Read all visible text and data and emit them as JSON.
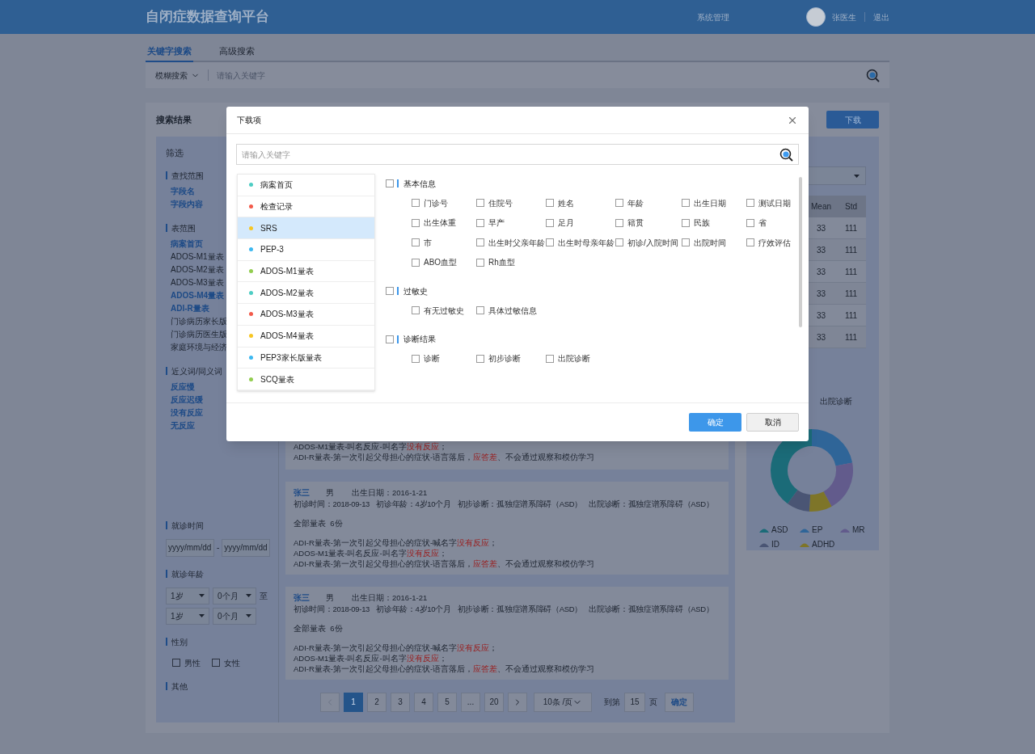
{
  "header": {
    "title": "自闭症数据查询平台",
    "nav": "系统管理",
    "user": "张医生",
    "logout": "退出"
  },
  "search_tabs": [
    {
      "label": "关键字搜索",
      "selected": true
    },
    {
      "label": "高级搜索",
      "selected": false
    }
  ],
  "search_bar": {
    "mode": "模糊搜索",
    "placeholder": "请输入关键字"
  },
  "results": {
    "title": "搜索结果",
    "download_button": "下载"
  },
  "filters": {
    "title": "筛选",
    "sections": [
      {
        "kind": "links",
        "title": "查找范围",
        "items": [
          {
            "label": "字段名",
            "selected": true
          },
          {
            "label": "字段内容",
            "selected": true
          }
        ]
      },
      {
        "kind": "links",
        "title": "表范围",
        "items": [
          {
            "label": "病案首页",
            "selected": true
          },
          {
            "label": "ADOS-M1量表",
            "selected": false
          },
          {
            "label": "ADOS-M2量表",
            "selected": false
          },
          {
            "label": "ADOS-M3量表",
            "selected": false
          },
          {
            "label": "ADOS-M4量表",
            "selected": true
          },
          {
            "label": "ADI-R量表",
            "selected": true
          },
          {
            "label": "门诊病历家长版",
            "selected": false
          },
          {
            "label": "门诊病历医生版",
            "selected": false
          },
          {
            "label": "家庭环境与经济",
            "selected": false
          }
        ]
      },
      {
        "kind": "links",
        "title": "近义词/同义词",
        "items": [
          {
            "label": "反应慢",
            "selected": true
          },
          {
            "label": "反应迟缓",
            "selected": true
          },
          {
            "label": "没有反应",
            "selected": true
          },
          {
            "label": "无反应",
            "selected": true
          }
        ]
      },
      {
        "kind": "dates",
        "title": "就诊时间",
        "separator": "-",
        "fields": [
          {
            "placeholder": "yyyy/mm/dd"
          },
          {
            "placeholder": "yyyy/mm/dd"
          }
        ]
      },
      {
        "kind": "ages",
        "title": "就诊年龄",
        "to": "至",
        "rows": [
          [
            "1岁",
            "0个月"
          ],
          [
            "1岁",
            "0个月"
          ]
        ]
      },
      {
        "kind": "checks",
        "title": "性别",
        "items": [
          {
            "label": "男性",
            "checked": false
          },
          {
            "label": "女性",
            "checked": false
          }
        ]
      },
      {
        "kind": "links",
        "title": "其他"
      }
    ]
  },
  "records": [
    {
      "lines": [
        [
          {
            "text": "ADOS-M1量表-叫名反应-叫名字",
            "highlight": false
          },
          {
            "text": "没有反应",
            "highlight": true
          },
          {
            "text": "；",
            "highlight": false
          }
        ],
        [
          {
            "text": "ADI-R量表-第一次引起父母担心的症状-语言落后，",
            "highlight": false
          },
          {
            "text": "应答差",
            "highlight": true
          },
          {
            "text": "、不会通过观察和模仿学习",
            "highlight": false
          }
        ]
      ]
    },
    {
      "name": "张三",
      "gender": "男",
      "birth": "出生日期：2016-1-21",
      "details": [
        "初诊时间：2018-09-13",
        "初诊年龄：4岁10个月",
        "初步诊断：孤独症谱系障碍（ASD）",
        "出院诊断：孤独症谱系障碍（ASD）"
      ],
      "scale_count": "全部量表  6份",
      "lines": [
        [
          {
            "text": "ADI-R量表-第一次引起父母担心的症状-喊名字",
            "highlight": false
          },
          {
            "text": "没有反应",
            "highlight": true
          },
          {
            "text": "；",
            "highlight": false
          }
        ],
        [
          {
            "text": "ADOS-M1量表-叫名反应-叫名字",
            "highlight": false
          },
          {
            "text": "没有反应",
            "highlight": true
          },
          {
            "text": "；",
            "highlight": false
          }
        ],
        [
          {
            "text": "ADI-R量表-第一次引起父母担心的症状-语言落后，",
            "highlight": false
          },
          {
            "text": "应答差",
            "highlight": true
          },
          {
            "text": "、不会通过观察和模仿学习",
            "highlight": false
          }
        ]
      ]
    },
    {
      "name": "张三",
      "gender": "男",
      "birth": "出生日期：2016-1-21",
      "details": [
        "初诊时间：2018-09-13",
        "初诊年龄：4岁10个月",
        "初步诊断：孤独症谱系障碍（ASD）",
        "出院诊断：孤独症谱系障碍（ASD）"
      ],
      "scale_count": "全部量表  6份",
      "lines": [
        [
          {
            "text": "ADI-R量表-第一次引起父母担心的症状-喊名字",
            "highlight": false
          },
          {
            "text": "没有反应",
            "highlight": true
          },
          {
            "text": "；",
            "highlight": false
          }
        ],
        [
          {
            "text": "ADOS-M1量表-叫名反应-叫名字",
            "highlight": false
          },
          {
            "text": "没有反应",
            "highlight": true
          },
          {
            "text": "；",
            "highlight": false
          }
        ],
        [
          {
            "text": "ADI-R量表-第一次引起父母担心的症状-语言落后，",
            "highlight": false
          },
          {
            "text": "应答差",
            "highlight": true
          },
          {
            "text": "、不会通过观察和模仿学习",
            "highlight": false
          }
        ]
      ]
    }
  ],
  "pagination": {
    "prev_disabled": true,
    "pages": [
      {
        "label": "1",
        "selected": true
      },
      {
        "label": "2",
        "selected": false
      },
      {
        "label": "3",
        "selected": false
      },
      {
        "label": "4",
        "selected": false
      },
      {
        "label": "5",
        "selected": false
      },
      {
        "label": "...",
        "selected": false
      },
      {
        "label": "20",
        "selected": false
      }
    ],
    "page_size": "10条 /页",
    "goto_label": "到第",
    "goto_value": "15",
    "page_unit": "页",
    "confirm": "确定"
  },
  "stats": {
    "columns": [
      "Mean",
      "Std"
    ],
    "rows": [
      [
        "33",
        "111"
      ],
      [
        "33",
        "111"
      ],
      [
        "33",
        "111"
      ],
      [
        "33",
        "111"
      ],
      [
        "33",
        "111"
      ],
      [
        "33",
        "111"
      ]
    ]
  },
  "chart": {
    "title": "出院诊断",
    "legend": [
      {
        "label": "ASD",
        "color": "#1b6b78"
      },
      {
        "label": "EP",
        "color": "#2f6598"
      },
      {
        "label": "MR",
        "color": "#625b8c"
      },
      {
        "label": "ID",
        "color": "#4a5574"
      },
      {
        "label": "ADHD",
        "color": "#7e7529"
      }
    ]
  },
  "download_dialog": {
    "title": "下载项",
    "search_placeholder": "请输入关键字",
    "tables": [
      {
        "label": "病案首页",
        "color": "#4ecdc4",
        "selected": false
      },
      {
        "label": "检查记录",
        "color": "#f25a4a",
        "selected": false
      },
      {
        "label": "SRS",
        "color": "#f7c623",
        "selected": true
      },
      {
        "label": "PEP-3",
        "color": "#3cb8f0",
        "selected": false
      },
      {
        "label": "ADOS-M1量表",
        "color": "#92cd4f",
        "selected": false
      },
      {
        "label": "ADOS-M2量表",
        "color": "#4ecdc4",
        "selected": false
      },
      {
        "label": "ADOS-M3量表",
        "color": "#f25a4a",
        "selected": false
      },
      {
        "label": "ADOS-M4量表",
        "color": "#f7c623",
        "selected": false
      },
      {
        "label": "PEP3家长版量表",
        "color": "#3cb8f0",
        "selected": false
      },
      {
        "label": "SCQ量表",
        "color": "#92cd4f",
        "selected": false
      }
    ],
    "groups": [
      {
        "title": "基本信息",
        "checked": false,
        "options": [
          {
            "label": "门诊号",
            "checked": false
          },
          {
            "label": "住院号",
            "checked": false
          },
          {
            "label": "姓名",
            "checked": false
          },
          {
            "label": "年龄",
            "checked": false
          },
          {
            "label": "出生日期",
            "checked": false
          },
          {
            "label": "测试日期",
            "checked": false
          },
          {
            "label": "出生体重",
            "checked": false
          },
          {
            "label": "早产",
            "checked": false
          },
          {
            "label": "足月",
            "checked": false
          },
          {
            "label": "籍贯",
            "checked": false
          },
          {
            "label": "民族",
            "checked": false
          },
          {
            "label": "省",
            "checked": false
          },
          {
            "label": "市",
            "checked": false
          },
          {
            "label": "出生时父亲年龄",
            "checked": false
          },
          {
            "label": "出生时母亲年龄",
            "checked": false
          },
          {
            "label": "初诊/入院时间",
            "checked": false
          },
          {
            "label": "出院时间",
            "checked": false
          },
          {
            "label": "疗效评估",
            "checked": false
          },
          {
            "label": "ABO血型",
            "checked": false
          },
          {
            "label": "Rh血型",
            "checked": false
          }
        ]
      },
      {
        "title": "过敏史",
        "checked": false,
        "options": [
          {
            "label": "有无过敏史",
            "checked": false
          },
          {
            "label": "具体过敏信息",
            "checked": false
          }
        ]
      },
      {
        "title": "诊断结果",
        "checked": false,
        "options": [
          {
            "label": "诊断",
            "checked": false
          },
          {
            "label": "初步诊断",
            "checked": false
          },
          {
            "label": "出院诊断",
            "checked": false
          }
        ]
      }
    ],
    "confirm": "确定",
    "cancel": "取消"
  }
}
